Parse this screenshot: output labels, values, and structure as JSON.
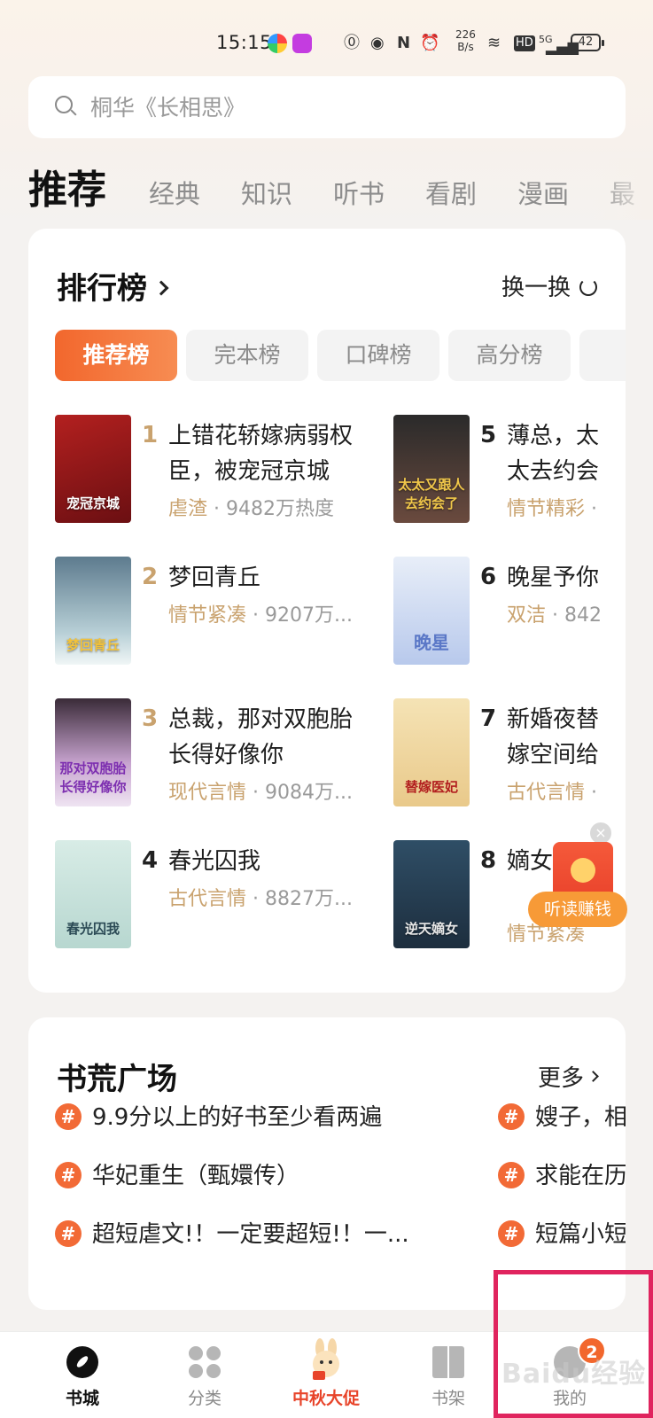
{
  "status_bar": {
    "time": "15:15",
    "net_speed": "226",
    "net_unit": "B/s",
    "hd": "HD",
    "signal": "5G",
    "battery": "42"
  },
  "search": {
    "placeholder": "桐华《长相思》"
  },
  "tabs": [
    "推荐",
    "经典",
    "知识",
    "听书",
    "看剧",
    "漫画",
    "最"
  ],
  "ranking": {
    "title": "排行榜",
    "swap_label": "换一换",
    "chips": [
      "推荐榜",
      "完本榜",
      "口碑榜",
      "高分榜"
    ],
    "books": [
      {
        "rank": "1",
        "title": "上错花轿嫁病弱权臣，被宠冠京城",
        "tag": "虐渣",
        "meta": "9482万热度",
        "cover_text": "宠冠京城"
      },
      {
        "rank": "2",
        "title": "梦回青丘",
        "tag": "情节紧凑",
        "meta": "9207万...",
        "cover_text": "梦回青丘"
      },
      {
        "rank": "3",
        "title": "总裁，那对双胞胎长得好像你",
        "tag": "现代言情",
        "meta": "9084万...",
        "cover_text": "那对双胞胎长得好像你"
      },
      {
        "rank": "4",
        "title": "春光囚我",
        "tag": "古代言情",
        "meta": "8827万...",
        "cover_text": "春光囚我"
      },
      {
        "rank": "5",
        "title": "薄总，太太去约会了",
        "tag": "情节精彩",
        "meta": "",
        "cover_text": "太太又跟人去约会了"
      },
      {
        "rank": "6",
        "title": "晚星予你",
        "tag": "双洁",
        "meta": "842",
        "cover_text": "晚星"
      },
      {
        "rank": "7",
        "title": "新婚夜替嫁空间给战",
        "tag": "古代言情",
        "meta": "",
        "cover_text": "替嫁医妃"
      },
      {
        "rank": "8",
        "title": "嫡女",
        "tag": "情节紧凑",
        "meta": "",
        "cover_text": "逆天嫡女"
      }
    ]
  },
  "red_packet": {
    "label": "听读赚钱",
    "close": "×"
  },
  "plaza": {
    "title": "书荒广场",
    "more": "更多",
    "topics_left": [
      "9.9分以上的好书至少看两遍",
      "华妃重生（甄嬛传）",
      "超短虐文!！一定要超短!！一..."
    ],
    "topics_right": [
      "嫂子，相",
      "求能在历",
      "短篇小短"
    ]
  },
  "bottom_nav": {
    "items": [
      "书城",
      "分类",
      "中秋大促",
      "书架",
      "我的"
    ],
    "badge": "2"
  },
  "watermark": "Baidu经验",
  "colors": {
    "accent": "#f2672d",
    "tag": "#c9a26e",
    "highlight": "#e0245e"
  }
}
